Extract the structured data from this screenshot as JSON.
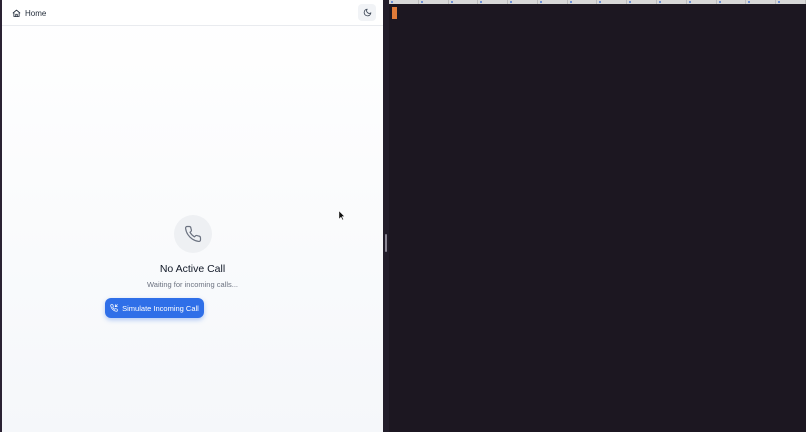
{
  "header": {
    "home_label": "Home"
  },
  "call": {
    "title": "No Active Call",
    "subtitle": "Waiting for incoming calls...",
    "simulate_label": "Simulate Incoming Call"
  },
  "icons": {
    "home": "home-icon",
    "theme": "moon-icon",
    "phone": "phone-icon",
    "incoming": "phone-incoming-icon"
  },
  "colors": {
    "accent": "#2f6fe8",
    "terminal_bg": "#1c1721",
    "terminal_cursor": "#e07b39"
  }
}
